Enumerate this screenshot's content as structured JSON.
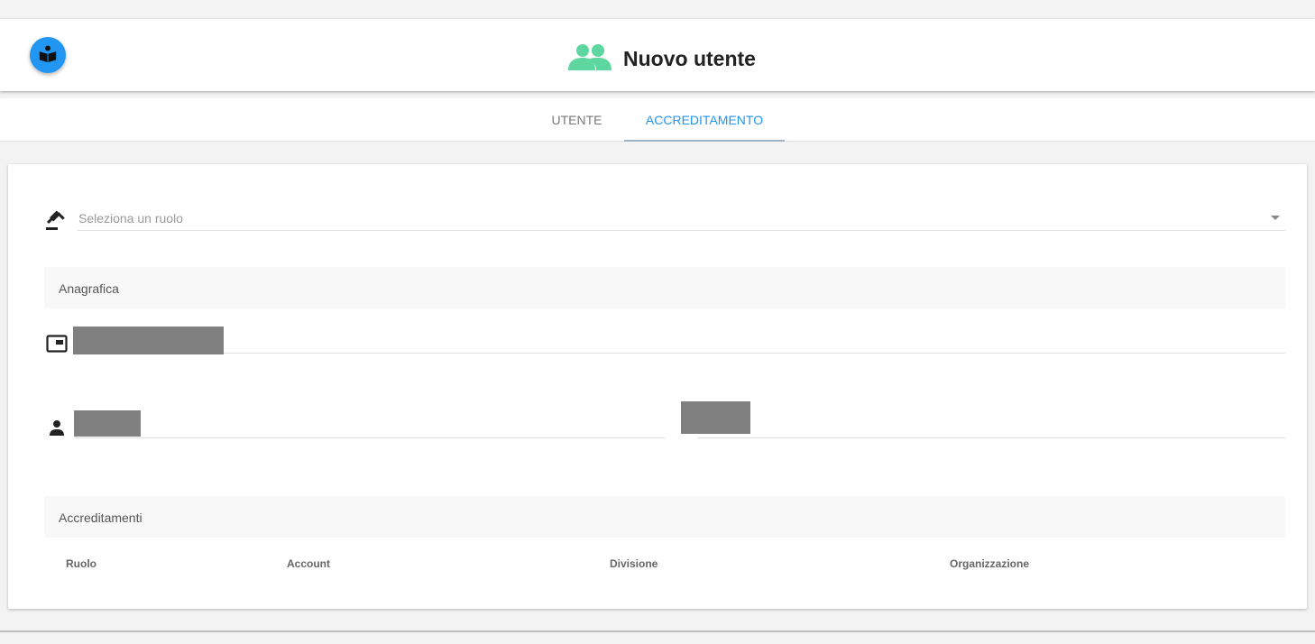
{
  "header": {
    "title": "Nuovo utente",
    "title_icon": "group-icon",
    "app_icon": "book-reader-icon",
    "accent_color": "#2196f3",
    "title_icon_color": "#5ed6a0"
  },
  "tabs": [
    {
      "label": "UTENTE",
      "active": false
    },
    {
      "label": "ACCREDITAMENTO",
      "active": true
    }
  ],
  "form": {
    "role_select": {
      "placeholder": "Seleziona un ruolo",
      "icon": "gavel-icon"
    },
    "anagrafica_title": "Anagrafica",
    "id_card_icon": "id-card-icon",
    "person_icon": "person-icon",
    "accreditamenti_title": "Accreditamenti",
    "table_headers": [
      "Ruolo",
      "Account",
      "Divisione",
      "Organizzazione"
    ]
  }
}
